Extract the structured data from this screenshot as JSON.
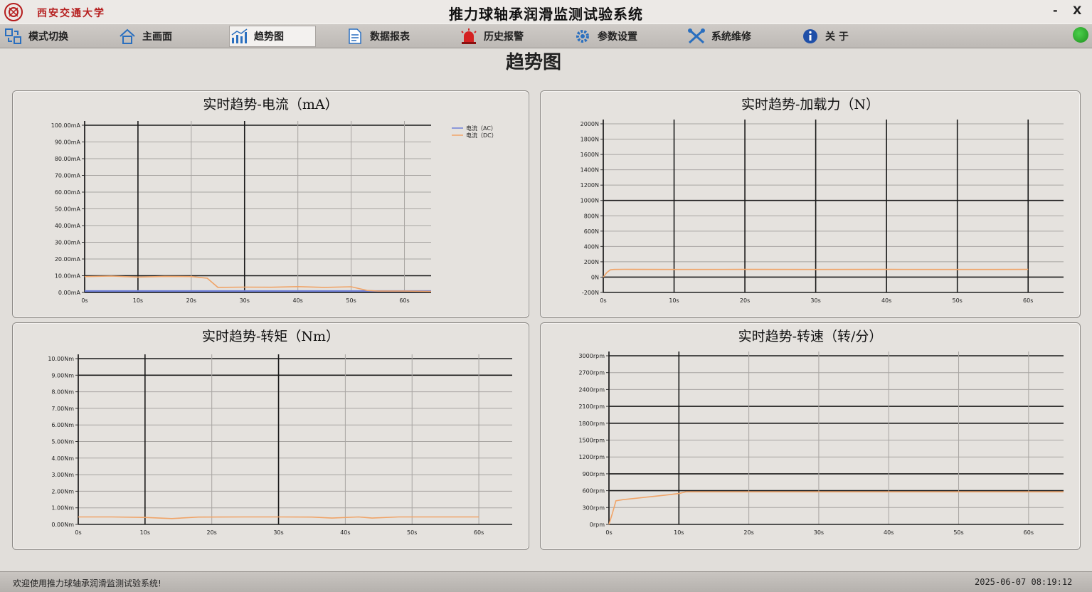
{
  "window": {
    "university": "西安交通大学",
    "title": "推力球轴承润滑监测试验系统",
    "minimize": "-",
    "close": "X"
  },
  "nav": [
    {
      "label": "模式切换",
      "icon": "mode-switch-icon"
    },
    {
      "label": "主画面",
      "icon": "home-icon"
    },
    {
      "label": "趋势图",
      "icon": "trend-chart-icon",
      "active": true
    },
    {
      "label": "数据报表",
      "icon": "report-document-icon"
    },
    {
      "label": "历史报警",
      "icon": "alarm-siren-icon"
    },
    {
      "label": "参数设置",
      "icon": "gear-icon"
    },
    {
      "label": "系统维修",
      "icon": "tools-icon"
    },
    {
      "label": "关 于",
      "icon": "info-icon"
    }
  ],
  "page_title": "趋势图",
  "colors": {
    "series_blue": "#6f7fd8",
    "series_orange": "#f0a468",
    "status_ok": "#2aa52a"
  },
  "status": {
    "message": "欢迎使用推力球轴承润滑监测试验系统!",
    "time": "2025-06-07 08:19:12"
  },
  "chart_data": [
    {
      "type": "line",
      "title": "实时趋势-电流（mA）",
      "yticks": [
        "100.00mA",
        "90.00mA",
        "80.00mA",
        "70.00mA",
        "60.00mA",
        "50.00mA",
        "40.00mA",
        "30.00mA",
        "20.00mA",
        "10.00mA",
        "0.00mA"
      ],
      "xticks": [
        "0s",
        "10s",
        "20s",
        "30s",
        "40s",
        "50s",
        "60s"
      ],
      "ylim": [
        0,
        100
      ],
      "xlim": [
        0,
        65
      ],
      "legend": [
        "电流（AC）",
        "电流（DC）"
      ],
      "series": [
        {
          "name": "电流（AC）",
          "color": "#6f7fd8",
          "x": [
            0,
            65
          ],
          "y": [
            0.8,
            0.8
          ]
        },
        {
          "name": "电流（DC）",
          "color": "#f0a468",
          "x": [
            0,
            5,
            10,
            15,
            20,
            23,
            25,
            30,
            35,
            40,
            45,
            50,
            53,
            55,
            60,
            65
          ],
          "y": [
            9.5,
            9.8,
            9.2,
            9.6,
            9.5,
            8.5,
            3,
            3.2,
            3.1,
            3.5,
            3,
            3.4,
            1.2,
            0.8,
            0.8,
            0.6
          ]
        }
      ]
    },
    {
      "type": "line",
      "title": "实时趋势-加载力（N）",
      "yticks": [
        "2000N",
        "1800N",
        "1600N",
        "1400N",
        "1200N",
        "1000N",
        "800N",
        "600N",
        "400N",
        "200N",
        "0N",
        "-200N"
      ],
      "xticks": [
        "0s",
        "10s",
        "20s",
        "30s",
        "40s",
        "50s",
        "60s"
      ],
      "ylim": [
        -200,
        2000
      ],
      "xlim": [
        0,
        65
      ],
      "series": [
        {
          "color": "#f0a468",
          "x": [
            0,
            0.5,
            1,
            1.5,
            3,
            10,
            20,
            30,
            40,
            50,
            60
          ],
          "y": [
            0,
            60,
            95,
            100,
            102,
            100,
            101,
            100,
            101,
            100,
            101
          ]
        }
      ]
    },
    {
      "type": "line",
      "title": "实时趋势-转矩（Nm）",
      "yticks": [
        "10.00Nm",
        "9.00Nm",
        "8.00Nm",
        "7.00Nm",
        "6.00Nm",
        "5.00Nm",
        "4.00Nm",
        "3.00Nm",
        "2.00Nm",
        "1.00Nm",
        "0.00Nm"
      ],
      "xticks": [
        "0s",
        "10s",
        "20s",
        "30s",
        "40s",
        "50s",
        "60s"
      ],
      "ylim": [
        0,
        10
      ],
      "xlim": [
        0,
        65
      ],
      "series": [
        {
          "color": "#f0a468",
          "x": [
            0,
            5,
            10,
            14,
            18,
            25,
            30,
            35,
            38,
            42,
            44,
            48,
            55,
            60
          ],
          "y": [
            0.45,
            0.45,
            0.42,
            0.35,
            0.44,
            0.45,
            0.45,
            0.44,
            0.38,
            0.45,
            0.38,
            0.45,
            0.45,
            0.45
          ]
        }
      ]
    },
    {
      "type": "line",
      "title": "实时趋势-转速（转/分）",
      "yticks": [
        "3000rpm",
        "2700rpm",
        "2400rpm",
        "2100rpm",
        "1800rpm",
        "1500rpm",
        "1200rpm",
        "900rpm",
        "600rpm",
        "300rpm",
        "0rpm"
      ],
      "xticks": [
        "0s",
        "10s",
        "20s",
        "30s",
        "40s",
        "50s",
        "60s"
      ],
      "ylim": [
        0,
        3000
      ],
      "xlim": [
        0,
        65
      ],
      "series": [
        {
          "color": "#f0a468",
          "x": [
            0,
            0.5,
            1,
            2,
            5,
            8,
            10,
            11,
            20,
            30,
            40,
            50,
            60,
            65
          ],
          "y": [
            0,
            200,
            420,
            440,
            480,
            520,
            550,
            580,
            580,
            580,
            580,
            580,
            580,
            580
          ]
        }
      ]
    }
  ]
}
